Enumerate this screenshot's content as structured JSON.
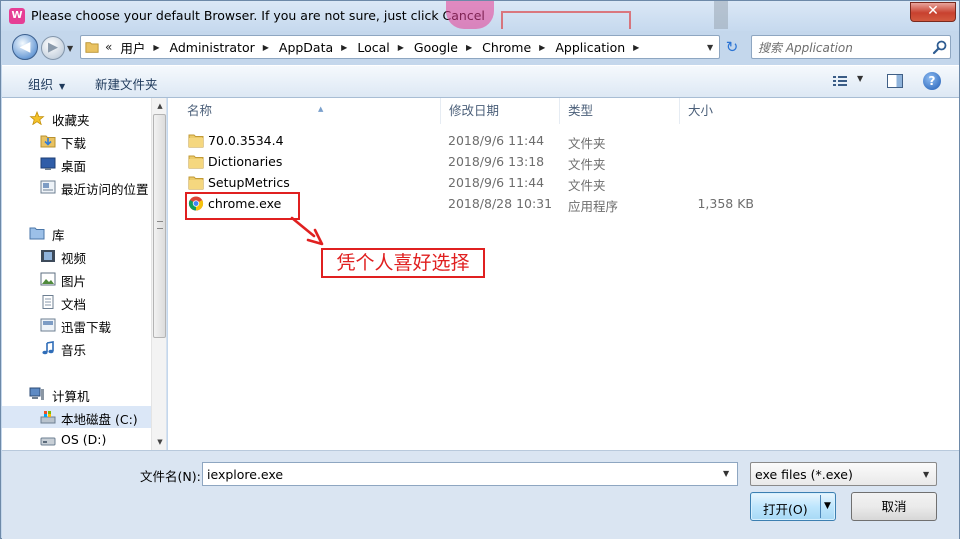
{
  "window": {
    "title": "Please choose your default Browser. If you are not sure, just click Cancel",
    "app_icon_letter": "W",
    "close_glyph": "✕"
  },
  "navigation": {
    "back_glyph": "◀",
    "forward_glyph": "▶",
    "recent_glyph": "▼",
    "overflow_glyph": "«",
    "breadcrumbs": [
      "用户",
      "Administrator",
      "AppData",
      "Local",
      "Google",
      "Chrome",
      "Application"
    ],
    "search_placeholder": "搜索 Application",
    "refresh_glyph": "↻"
  },
  "toolbar": {
    "organize_label": "组织",
    "organize_caret": "▼",
    "new_folder_label": "新建文件夹",
    "help_glyph": "?"
  },
  "sidebar": {
    "favorites": "收藏夹",
    "downloads": "下载",
    "desktop": "桌面",
    "recent_places": "最近访问的位置",
    "libraries": "库",
    "videos": "视频",
    "pictures": "图片",
    "documents": "文档",
    "xunlei": "迅雷下载",
    "music": "音乐",
    "computer": "计算机",
    "local_disk": "本地磁盘 (C:)",
    "os_drive": "OS (D:)"
  },
  "columns": {
    "name": "名称",
    "modified": "修改日期",
    "type": "类型",
    "size": "大小"
  },
  "files": [
    {
      "name": "70.0.3534.4",
      "modified": "2018/9/6 11:44",
      "type": "文件夹",
      "size": "",
      "icon": "folder-icon"
    },
    {
      "name": "Dictionaries",
      "modified": "2018/9/6 13:18",
      "type": "文件夹",
      "size": "",
      "icon": "folder-icon"
    },
    {
      "name": "SetupMetrics",
      "modified": "2018/9/6 11:44",
      "type": "文件夹",
      "size": "",
      "icon": "folder-icon"
    },
    {
      "name": "chrome.exe",
      "modified": "2018/8/28 10:31",
      "type": "应用程序",
      "size": "1,358 KB",
      "icon": "chrome-icon"
    }
  ],
  "annotation": {
    "text": "凭个人喜好选择",
    "color": "#e02020"
  },
  "bottom": {
    "filename_label": "文件名(N):",
    "filename_value": "iexplore.exe",
    "filetype_value": "exe files (*.exe)",
    "open_label": "打开(O)",
    "cancel_label": "取消",
    "dropdown_glyph": "▼"
  },
  "colors": {
    "frame": "#c4d7ec",
    "accent": "#2c74d4",
    "annotation_red": "#e02020",
    "selection": "#dbe7f7"
  }
}
